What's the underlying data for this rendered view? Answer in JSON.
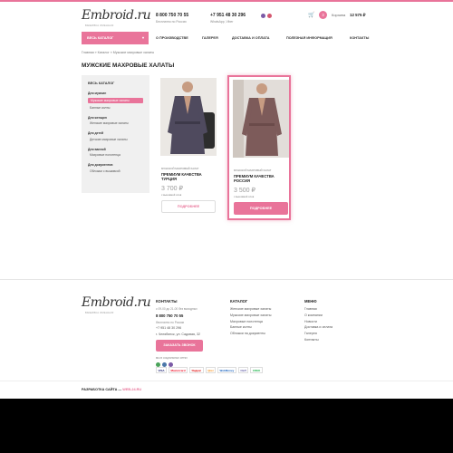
{
  "header": {
    "logo_text": "Embroid.ru",
    "logo_tagline": "ВЫШИВКА ИМЕННАЯ",
    "phone1": "8 800 750 70 55",
    "phone1_sub": "Бесплатно по России",
    "phone2": "+7 951 48 30 296",
    "phone2_sub": "WhatsApp, Viber",
    "cart_count": "3",
    "cart_label": "Корзина",
    "cart_sum": "12 575 ₽"
  },
  "nav": {
    "catalog": "ВЕСЬ КАТАЛОГ",
    "items": [
      "О ПРОИЗВОДСТВЕ",
      "ГАЛЕРЕЯ",
      "ДОСТАВКА И ОПЛАТА",
      "ПОЛЕЗНАЯ ИНФОРМАЦИЯ",
      "КОНТАКТЫ"
    ]
  },
  "breadcrumb": "Главная » Каталог » Мужские махровые халаты",
  "page_title": "МУЖСКИЕ МАХРОВЫЕ ХАЛАТЫ",
  "sidebar": {
    "all": "ВЕСЬ КАТАЛОГ",
    "groups": [
      {
        "title": "Для мужчин",
        "items": [
          "Мужские махровые халаты",
          "Банные килты"
        ]
      },
      {
        "title": "Для женщин",
        "items": [
          "Женские махровые халаты"
        ]
      },
      {
        "title": "Для детей",
        "items": [
          "Детские махровые халаты"
        ]
      },
      {
        "title": "Для ванной",
        "items": [
          "Махровые полотенца"
        ]
      },
      {
        "title": "Для документов",
        "items": [
          "Обложки с вышивкой"
        ]
      }
    ]
  },
  "products": [
    {
      "category": "МУЖСКОЙ МАХРОВЫЙ ХАЛАТ",
      "name": "ПРЕМИУМ КАЧЕСТВА ТУРЦИЯ",
      "price": "3 700 ₽",
      "note": "с вышивкой слов",
      "button": "ПОДРОБНЕЕ"
    },
    {
      "category": "МУЖСКОЙ МАХРОВЫЙ ХАЛАТ",
      "name": "ПРЕМИУМ КАЧЕСТВА РОССИЯ",
      "price": "3 500 ₽",
      "note": "с вышивкой слов",
      "button": "ПОДРОБНЕЕ"
    }
  ],
  "footer": {
    "contacts_title": "КОНТАКТЫ",
    "hours": "с 09-00 до 21-00 без выходных",
    "phone1": "8 800 750 70 55",
    "phone1_sub": "бесплатно по России",
    "phone2": "+7 951 48 30 296",
    "address": "г. Челябинск, ул. Садовая, 32",
    "call_button": "ЗАКАЗАТЬ ЗВОНОК",
    "social_label": "мы в социальных сетях",
    "catalog_title": "КАТАЛОГ",
    "catalog_items": [
      "Женские махровые халаты",
      "Мужские махровые халаты",
      "Махровые полотенца",
      "Банные килты",
      "Обложки на документы"
    ],
    "menu_title": "МЕНЮ",
    "menu_items": [
      "Главная",
      "О компании",
      "Новости",
      "Доставка и оплата",
      "Галерея",
      "Контакты"
    ],
    "payments": [
      "VISA",
      "Mastercard",
      "Яндекс",
      "Qiwi",
      "WebMoney",
      "СБП",
      "CDEK"
    ],
    "dev_label": "РАЗРАБОТКА САЙТА —",
    "dev_name": "WEB-24.RU"
  },
  "colors": {
    "accent": "#e9749a"
  }
}
